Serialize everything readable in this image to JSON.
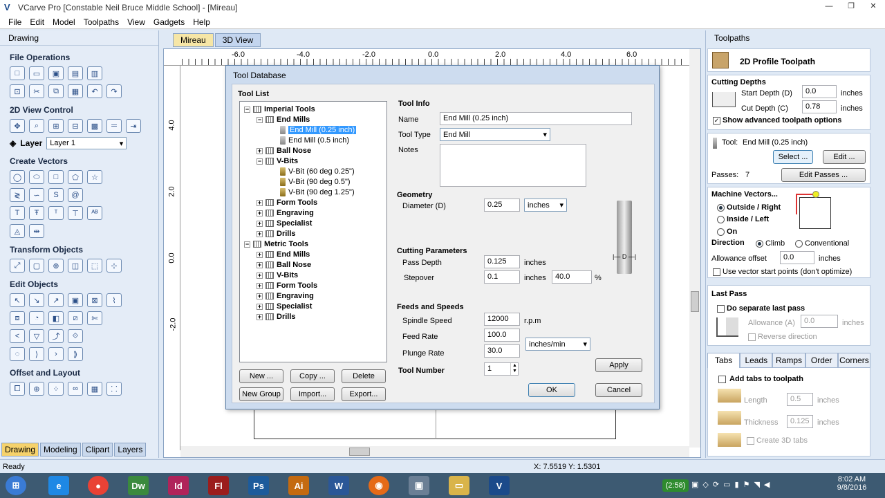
{
  "app": {
    "title": "VCarve Pro [Constable Neil Bruce Middle School] - [Mireau]"
  },
  "window_controls": {
    "minimize": "—",
    "restore": "❐",
    "close": "✕"
  },
  "menu": [
    "File",
    "Edit",
    "Model",
    "Toolpaths",
    "View",
    "Gadgets",
    "Help"
  ],
  "left_panel": {
    "header": "Drawing",
    "sections": {
      "file_operations": "File Operations",
      "view_control": "2D View Control",
      "layer_label": "Layer",
      "layer_value": "Layer 1",
      "create_vectors": "Create Vectors",
      "transform_objects": "Transform Objects",
      "edit_objects": "Edit Objects",
      "offset_layout": "Offset and Layout"
    },
    "bottom_tabs": [
      "Drawing",
      "Modeling",
      "Clipart",
      "Layers"
    ]
  },
  "view_tabs": [
    "Mireau",
    "3D View"
  ],
  "ruler": {
    "top": [
      "-6.0",
      "-4.0",
      "-2.0",
      "0.0",
      "2.0",
      "4.0",
      "6.0"
    ],
    "left": [
      "4.0",
      "2.0",
      "0.0",
      "-2.0"
    ]
  },
  "status": {
    "ready": "Ready",
    "coords": "X: 7.5519 Y: 1.5301"
  },
  "dialog": {
    "title": "Tool Database",
    "tool_list_label": "Tool List",
    "tree": [
      {
        "label": "Imperial Tools",
        "bold": true
      },
      {
        "label": "End Mills",
        "bold": true
      },
      {
        "label": "End Mill (0.25 inch)",
        "selected": true
      },
      {
        "label": "End Mill (0.5 inch)"
      },
      {
        "label": "Ball Nose",
        "bold": true
      },
      {
        "label": "V-Bits",
        "bold": true
      },
      {
        "label": "V-Bit (60 deg 0.25\")"
      },
      {
        "label": "V-Bit (90 deg 0.5\")"
      },
      {
        "label": "V-Bit (90 deg 1.25\")"
      },
      {
        "label": "Form Tools",
        "bold": true
      },
      {
        "label": "Engraving",
        "bold": true
      },
      {
        "label": "Specialist",
        "bold": true
      },
      {
        "label": "Drills",
        "bold": true
      },
      {
        "label": "Metric Tools",
        "bold": true
      },
      {
        "label": "End Mills",
        "bold": true
      },
      {
        "label": "Ball Nose",
        "bold": true
      },
      {
        "label": "V-Bits",
        "bold": true
      },
      {
        "label": "Form Tools",
        "bold": true
      },
      {
        "label": "Engraving",
        "bold": true
      },
      {
        "label": "Specialist",
        "bold": true
      },
      {
        "label": "Drills",
        "bold": true
      }
    ],
    "buttons": {
      "new": "New ...",
      "copy": "Copy ...",
      "delete": "Delete",
      "new_group": "New Group",
      "import": "Import...",
      "export": "Export...",
      "apply": "Apply",
      "ok": "OK",
      "cancel": "Cancel"
    },
    "tool_info": {
      "header": "Tool Info",
      "name_label": "Name",
      "name_value": "End Mill (0.25 inch)",
      "type_label": "Tool Type",
      "type_value": "End Mill",
      "notes_label": "Notes"
    },
    "geometry": {
      "header": "Geometry",
      "diameter_label": "Diameter (D)",
      "diameter_value": "0.25",
      "units": "inches"
    },
    "cutting": {
      "header": "Cutting Parameters",
      "pass_depth_label": "Pass Depth",
      "pass_depth_value": "0.125",
      "pass_depth_units": "inches",
      "stepover_label": "Stepover",
      "stepover_value": "0.1",
      "stepover_units": "inches",
      "stepover_pct": "40.0",
      "pct": "%"
    },
    "feeds": {
      "header": "Feeds and Speeds",
      "spindle_label": "Spindle Speed",
      "spindle_value": "12000",
      "spindle_units": "r.p.m",
      "feed_label": "Feed Rate",
      "feed_value": "100.0",
      "plunge_label": "Plunge Rate",
      "plunge_value": "30.0",
      "rate_units": "inches/min"
    },
    "tool_number": {
      "label": "Tool Number",
      "value": "1"
    }
  },
  "right_panel": {
    "header": "Toolpaths",
    "profile_title": "2D Profile Toolpath",
    "cutting_depths": "Cutting Depths",
    "start_depth_label": "Start Depth (D)",
    "start_depth_value": "0.0",
    "cut_depth_label": "Cut Depth (C)",
    "cut_depth_value": "0.78",
    "inches": "inches",
    "show_advanced": "Show advanced toolpath options",
    "tool_label": "Tool:",
    "tool_value": "End Mill (0.25 inch)",
    "select_btn": "Select ...",
    "edit_btn": "Edit ...",
    "passes_label": "Passes:",
    "passes_value": "7",
    "edit_passes_btn": "Edit Passes ...",
    "machine_vectors": "Machine Vectors...",
    "outside_right": "Outside / Right",
    "inside_left": "Inside / Left",
    "on": "On",
    "direction_label": "Direction",
    "climb": "Climb",
    "conventional": "Conventional",
    "allowance_label": "Allowance offset",
    "allowance_value": "0.0",
    "vector_start": "Use vector start points (don't optimize)",
    "last_pass": "Last Pass",
    "separate_last_pass": "Do separate last pass",
    "allowance_a_label": "Allowance (A)",
    "allowance_a_value": "0.0",
    "reverse_direction": "Reverse direction",
    "tabs": [
      "Tabs",
      "Leads",
      "Ramps",
      "Order",
      "Corners"
    ],
    "add_tabs": "Add tabs to toolpath",
    "length_label": "Length",
    "length_value": "0.5",
    "thickness_label": "Thickness",
    "thickness_value": "0.125",
    "create_3d_tabs": "Create 3D tabs"
  },
  "taskbar": {
    "battery": "(2:58)",
    "time": "8:02 AM",
    "date": "9/8/2016"
  }
}
